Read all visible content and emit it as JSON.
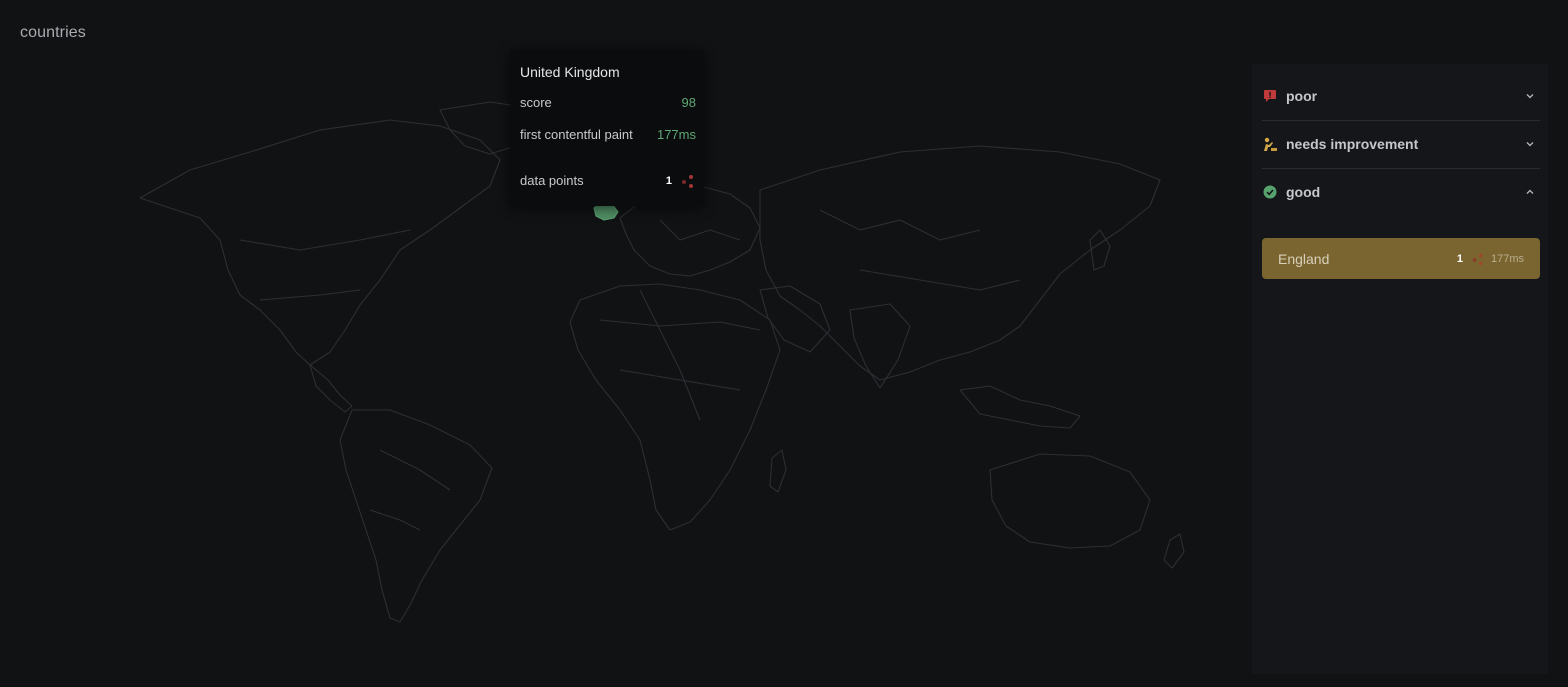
{
  "panel": {
    "title": "countries"
  },
  "tooltip": {
    "country": "United Kingdom",
    "rows": [
      {
        "label": "score",
        "value": "98"
      },
      {
        "label": "first contentful paint",
        "value": "177ms"
      },
      {
        "label": "data points",
        "value": "1"
      }
    ]
  },
  "sidebar": {
    "sections": [
      {
        "label": "poor",
        "icon": "alert-icon",
        "color": "#c0393b",
        "expanded": false
      },
      {
        "label": "needs improvement",
        "icon": "construction-worker-icon",
        "color": "#d4a84a",
        "expanded": false
      },
      {
        "label": "good",
        "icon": "check-circle-icon",
        "color": "#56a36e",
        "expanded": true
      }
    ],
    "good_items": [
      {
        "name": "England",
        "count": "1",
        "value": "177ms"
      }
    ]
  },
  "colors": {
    "background": "#111214",
    "map_outline": "#2c2f33",
    "good": "#56a36e",
    "poor": "#c0393b",
    "needs_improvement": "#d4a84a",
    "highlight_row": "#7a6530"
  }
}
